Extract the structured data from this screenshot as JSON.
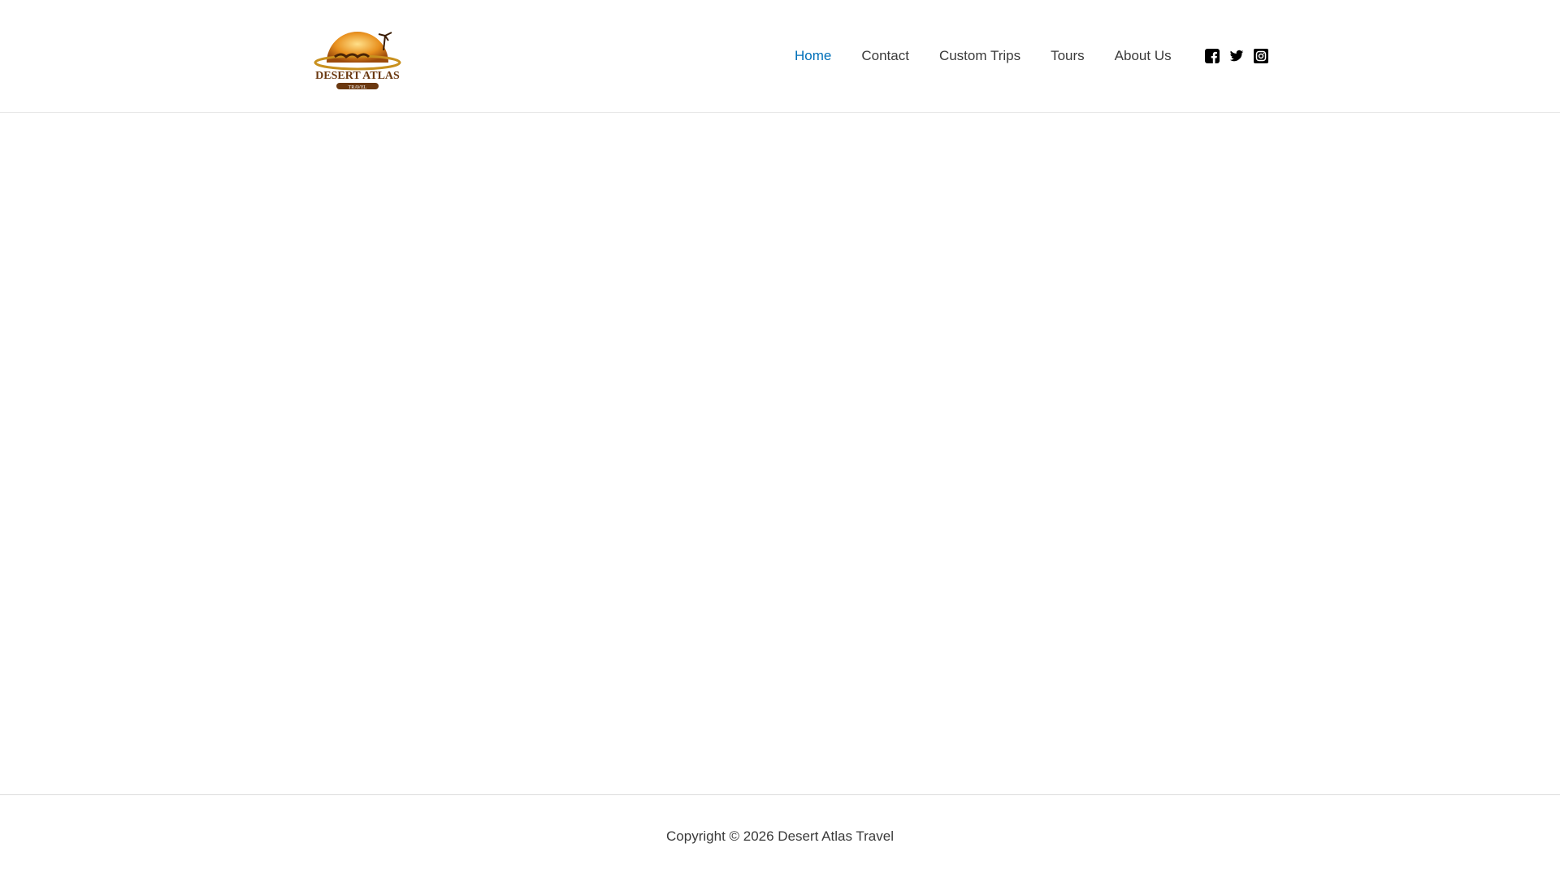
{
  "site": {
    "logo_text": "Desert Atlas Travel",
    "logo_subtext": "TRAVEL"
  },
  "nav": {
    "items": [
      {
        "label": "Home",
        "active": true
      },
      {
        "label": "Contact"
      },
      {
        "label": "Custom Trips"
      },
      {
        "label": "Tours"
      },
      {
        "label": "About Us"
      }
    ]
  },
  "social": [
    "facebook-icon",
    "twitter-icon",
    "instagram-icon"
  ],
  "footer": {
    "copyright": "Copyright © 2026 Desert Atlas Travel"
  },
  "colors": {
    "accent": "#0170B9",
    "text": "#3a3a3a"
  }
}
